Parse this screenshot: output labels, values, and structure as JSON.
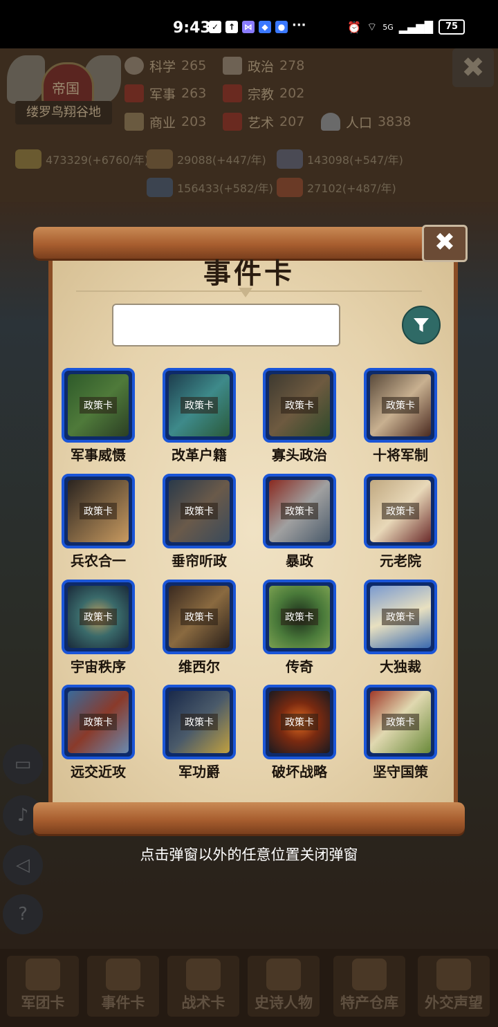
{
  "status_bar": {
    "time": "9:43",
    "battery": "75",
    "net": "5G",
    "icons": [
      "check-icon",
      "upload-icon",
      "bowtie-icon",
      "shield-icon",
      "bubble-icon"
    ]
  },
  "empire": {
    "title": "帝国",
    "name": "缕罗鸟翔谷地"
  },
  "stats": [
    {
      "name": "科学",
      "value": "265",
      "icon": "science-icon",
      "color": "#7a6a5a"
    },
    {
      "name": "政治",
      "value": "278",
      "icon": "politics-icon",
      "color": "#7a6a5a"
    },
    {
      "name": "军事",
      "value": "263",
      "icon": "military-icon",
      "color": "#6a2a20"
    },
    {
      "name": "宗教",
      "value": "202",
      "icon": "religion-icon",
      "color": "#6a2a20"
    },
    {
      "name": "商业",
      "value": "203",
      "icon": "commerce-icon",
      "color": "#6a5a40"
    },
    {
      "name": "艺术",
      "value": "207",
      "icon": "art-icon",
      "color": "#6a2a20"
    },
    {
      "name": "人口",
      "value": "3838",
      "icon": "population-icon",
      "color": "#6a6a6a"
    }
  ],
  "resources": [
    {
      "text": "473329(+6760/年)",
      "icon": "gold-icon"
    },
    {
      "text": "29088(+447/年)",
      "icon": "wood-icon"
    },
    {
      "text": "143098(+547/年)",
      "icon": "iron-icon"
    },
    {
      "text": "156433(+582/年)",
      "icon": "stone-icon"
    },
    {
      "text": "27102(+487/年)",
      "icon": "food-icon"
    }
  ],
  "modal": {
    "title": "事件卡",
    "search_value": "",
    "search_placeholder": "",
    "close_glyph": "✖",
    "card_tag": "政策卡",
    "cards": [
      {
        "label": "军事威慑"
      },
      {
        "label": "改革户籍"
      },
      {
        "label": "寡头政治"
      },
      {
        "label": "十将军制"
      },
      {
        "label": "兵农合一"
      },
      {
        "label": "垂帘听政"
      },
      {
        "label": "暴政"
      },
      {
        "label": "元老院"
      },
      {
        "label": "宇宙秩序"
      },
      {
        "label": "维西尔"
      },
      {
        "label": "传奇"
      },
      {
        "label": "大独裁"
      },
      {
        "label": "远交近攻"
      },
      {
        "label": "军功爵"
      },
      {
        "label": "破坏战略"
      },
      {
        "label": "坚守国策"
      }
    ]
  },
  "hint": "点击弹窗以外的任意位置关闭弹窗",
  "bottom_nav": [
    {
      "label": "军团卡",
      "icon": "helmet-icon"
    },
    {
      "label": "事件卡",
      "icon": "scroll-icon"
    },
    {
      "label": "战术卡",
      "icon": "crossed-swords-icon"
    },
    {
      "label": "史诗人物",
      "icon": "crown-icon"
    },
    {
      "label": "特产仓库",
      "icon": "chest-icon"
    },
    {
      "label": "外交声望",
      "icon": "letter-icon"
    }
  ],
  "side_buttons": [
    "chat-icon",
    "mute-music-icon",
    "mute-sound-icon",
    "help-icon"
  ]
}
